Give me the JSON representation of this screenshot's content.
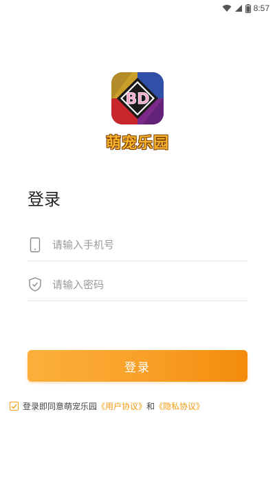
{
  "status_bar": {
    "time": "8:57",
    "icons": [
      "wifi-icon",
      "signal-icon",
      "battery-icon"
    ]
  },
  "app": {
    "logo_text": "BD",
    "name": "萌宠乐园"
  },
  "login": {
    "title": "登录",
    "phone_placeholder": "请输入手机号",
    "code_placeholder": "请输入密码",
    "button_label": "登录"
  },
  "agreement": {
    "prefix": "登录即同意萌宠乐园",
    "user_agreement": "《用户协议》",
    "conjunction": "和",
    "privacy_agreement": "《隐私协议》",
    "checked": true
  },
  "colors": {
    "accent": "#f39c12",
    "button_start": "#fbb03b",
    "button_end": "#f38b0a"
  }
}
